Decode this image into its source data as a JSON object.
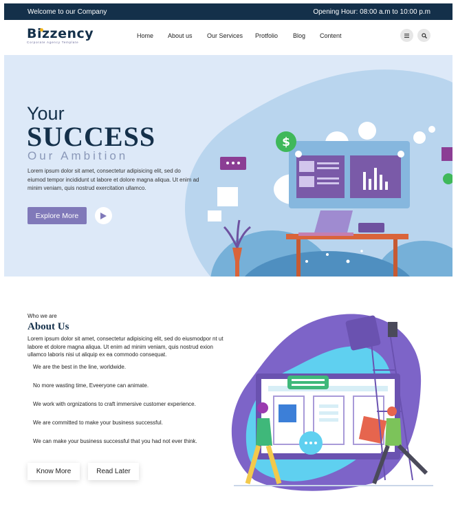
{
  "topbar": {
    "welcome": "Welcome to our Company",
    "hours": "Opening Hour: 08:00 a.m to 10:00 p.m"
  },
  "brand": {
    "name": "Bizzency",
    "tagline": "Corporate Agency Template"
  },
  "nav": {
    "items": [
      "Home",
      "About us",
      "Our Services",
      "Protfolio",
      "Blog",
      "Content"
    ],
    "menu_icon": "menu-icon",
    "search_icon": "search-icon"
  },
  "hero": {
    "line1": "Your",
    "line2": "SUCCESS",
    "line3": "Our Ambition",
    "description": "Lorem ipsum dolor sit amet, consectetur adipisicing elit, sed do eiumod tempor incididunt ut labore et dolore magna aliqua. Ut enim ad minim veniam, quis nostrud exercitation ullamco.",
    "cta_label": "Explore More",
    "play_icon": "play-icon"
  },
  "about": {
    "eyebrow": "Who we are",
    "title": "About Us",
    "description": "Lorem ipsum dolor sit amet, consectetur adipisicing elit, sed do eiusmodpor nt ut labore et dolore magna aliqua. Ut enim ad minim veniam, quis nostrud exion ullamco laboris nisi ut aliquip ex ea commodo consequat.",
    "points": [
      "We are the best in the line, worldwide.",
      "No more wasting time, Eveeryone can animate.",
      "We work with orgnizations to craft immersive customer experience.",
      "We are committed to make your business successful.",
      "We can make your business successful that you had not ever think."
    ],
    "primary_button": "Know More",
    "secondary_button": "Read Later"
  },
  "colors": {
    "navy": "#14304a",
    "accent_purple": "#8079b9",
    "hero_bg": "#dde9f8",
    "logo_dot": "#f2b41b"
  }
}
